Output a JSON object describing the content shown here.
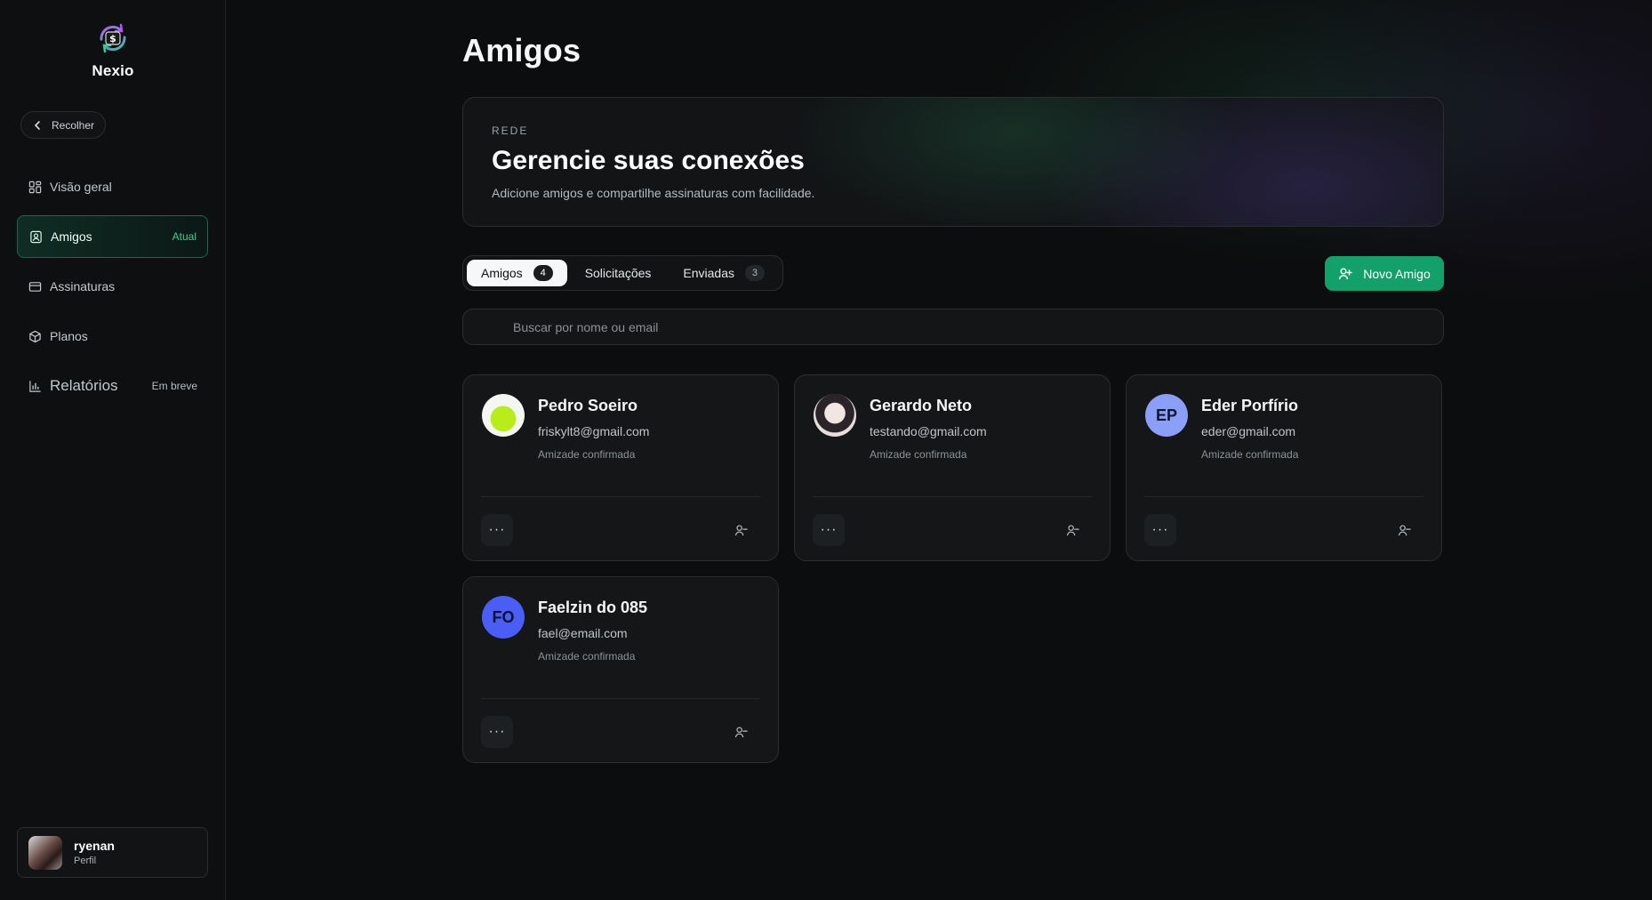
{
  "brand": {
    "name": "Nexio",
    "logo_icon": "dollar-cycle-icon"
  },
  "sidebar": {
    "collapse_label": "Recolher",
    "items": [
      {
        "label": "Visão geral",
        "icon": "dashboard-icon",
        "tag": ""
      },
      {
        "label": "Amigos",
        "icon": "contacts-icon",
        "tag": "Atual"
      },
      {
        "label": "Assinaturas",
        "icon": "credit-card-icon",
        "tag": ""
      },
      {
        "label": "Planos",
        "icon": "package-icon",
        "tag": ""
      },
      {
        "label": "Relatórios",
        "icon": "bar-chart-icon",
        "tag": "Em breve"
      }
    ],
    "profile": {
      "name": "ryenan",
      "subtitle": "Perfil"
    }
  },
  "header": {
    "title": "Amigos"
  },
  "hero": {
    "kicker": "REDE",
    "title": "Gerencie suas conexões",
    "subtitle": "Adicione amigos e compartilhe assinaturas com facilidade."
  },
  "tabs": [
    {
      "label": "Amigos",
      "count": "4"
    },
    {
      "label": "Solicitações",
      "count": ""
    },
    {
      "label": "Enviadas",
      "count": "3"
    }
  ],
  "new_button": {
    "label": "Novo Amigo"
  },
  "search": {
    "placeholder": "Buscar por nome ou email",
    "value": ""
  },
  "friends": [
    {
      "name": "Pedro Soeiro",
      "email": "friskylt8@gmail.com",
      "status": "Amizade confirmada",
      "initials": "",
      "avatar": "photo"
    },
    {
      "name": "Gerardo Neto",
      "email": "testando@gmail.com",
      "status": "Amizade confirmada",
      "initials": "",
      "avatar": "photo"
    },
    {
      "name": "Eder Porfírio",
      "email": "eder@gmail.com",
      "status": "Amizade confirmada",
      "initials": "EP",
      "avatar": "initials"
    },
    {
      "name": "Faelzin do 085",
      "email": "fael@email.com",
      "status": "Amizade confirmada",
      "initials": "FO",
      "avatar": "initials"
    }
  ],
  "colors": {
    "accent": "#14a06b",
    "active_nav": "#166b4f",
    "background": "#0c0d0e"
  }
}
